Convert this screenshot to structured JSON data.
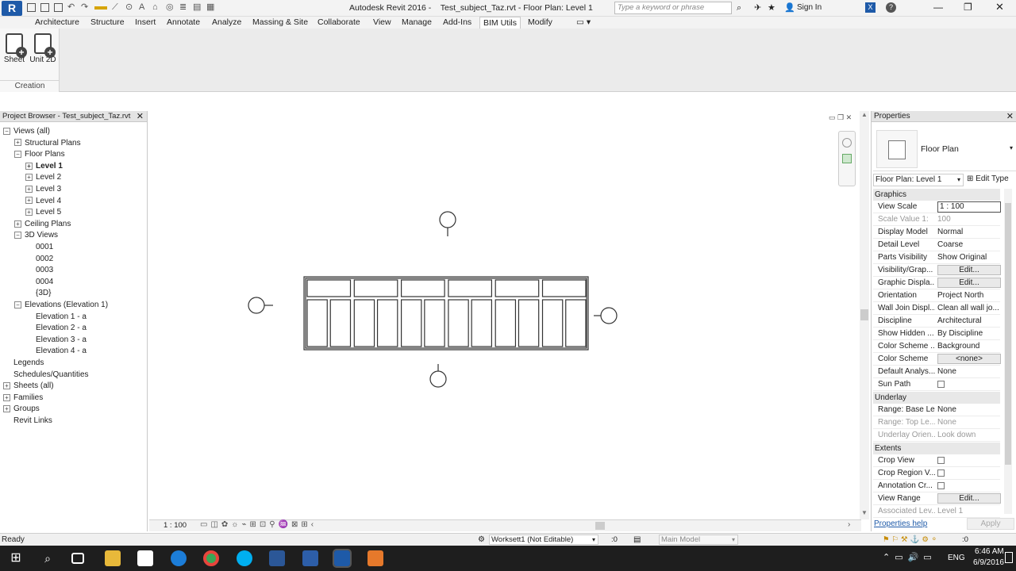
{
  "app": {
    "title": "Autodesk Revit 2016 -    Test_subject_Taz.rvt - Floor Plan: Level 1",
    "search_placeholder": "Type a keyword or phrase",
    "sign_in": "Sign In"
  },
  "ribbon": {
    "tabs": [
      "Architecture",
      "Structure",
      "Insert",
      "Annotate",
      "Analyze",
      "Massing & Site",
      "Collaborate",
      "View",
      "Manage",
      "Add-Ins",
      "BIM Utils",
      "Modify"
    ],
    "active_tab": "BIM Utils",
    "buttons": [
      {
        "label": "Sheet"
      },
      {
        "label": "Unit 2D"
      }
    ],
    "panel_label": "Creation"
  },
  "project_browser": {
    "title": "Project Browser - Test_subject_Taz.rvt",
    "items": [
      {
        "label": "Views (all)",
        "exp": "-"
      },
      {
        "label": "Structural Plans",
        "exp": "+"
      },
      {
        "label": "Floor Plans",
        "exp": "-"
      },
      {
        "label": "Level 1",
        "exp": "+",
        "bold": true
      },
      {
        "label": "Level 2",
        "exp": "+"
      },
      {
        "label": "Level 3",
        "exp": "+"
      },
      {
        "label": "Level 4",
        "exp": "+"
      },
      {
        "label": "Level 5",
        "exp": "+"
      },
      {
        "label": "Ceiling Plans",
        "exp": "+"
      },
      {
        "label": "3D Views",
        "exp": "-"
      },
      {
        "label": "0001",
        "exp": ""
      },
      {
        "label": "0002",
        "exp": ""
      },
      {
        "label": "0003",
        "exp": ""
      },
      {
        "label": "0004",
        "exp": ""
      },
      {
        "label": "{3D}",
        "exp": ""
      },
      {
        "label": "Elevations (Elevation 1)",
        "exp": "-"
      },
      {
        "label": "Elevation 1 - a",
        "exp": ""
      },
      {
        "label": "Elevation 2 - a",
        "exp": ""
      },
      {
        "label": "Elevation 3 - a",
        "exp": ""
      },
      {
        "label": "Elevation 4 - a",
        "exp": ""
      },
      {
        "label": "Legends",
        "exp": ""
      },
      {
        "label": "Schedules/Quantities",
        "exp": ""
      },
      {
        "label": "Sheets (all)",
        "exp": "+"
      },
      {
        "label": "Families",
        "exp": "+"
      },
      {
        "label": "Groups",
        "exp": "+"
      },
      {
        "label": "Revit Links",
        "exp": ""
      }
    ]
  },
  "view": {
    "scale": "1 : 100"
  },
  "properties": {
    "title": "Properties",
    "type_name": "Floor Plan",
    "instance": "Floor Plan: Level 1",
    "edit_type": "Edit Type",
    "sections": {
      "graphics": "Graphics",
      "underlay": "Underlay",
      "extents": "Extents"
    },
    "rows": [
      {
        "k": "View Scale",
        "v": "1 : 100"
      },
      {
        "k": "Scale Value    1:",
        "v": "100",
        "grey": true
      },
      {
        "k": "Display Model",
        "v": "Normal"
      },
      {
        "k": "Detail Level",
        "v": "Coarse"
      },
      {
        "k": "Parts Visibility",
        "v": "Show Original"
      },
      {
        "k": "Visibility/Grap...",
        "v": "Edit..."
      },
      {
        "k": "Graphic Displa...",
        "v": "Edit..."
      },
      {
        "k": "Orientation",
        "v": "Project North"
      },
      {
        "k": "Wall Join Displ...",
        "v": "Clean all wall jo..."
      },
      {
        "k": "Discipline",
        "v": "Architectural"
      },
      {
        "k": "Show Hidden ...",
        "v": "By Discipline"
      },
      {
        "k": "Color Scheme ...",
        "v": "Background"
      },
      {
        "k": "Color Scheme",
        "v": "<none>"
      },
      {
        "k": "Default Analys...",
        "v": "None"
      },
      {
        "k": "Sun Path",
        "v": ""
      },
      {
        "k": "Range: Base Le...",
        "v": "None"
      },
      {
        "k": "Range: Top Le...",
        "v": "None",
        "grey": true
      },
      {
        "k": "Underlay Orien...",
        "v": "Look down",
        "grey": true
      },
      {
        "k": "Crop View",
        "v": ""
      },
      {
        "k": "Crop Region V...",
        "v": ""
      },
      {
        "k": "Annotation Cr...",
        "v": ""
      },
      {
        "k": "View Range",
        "v": "Edit..."
      },
      {
        "k": "Associated Lev...",
        "v": "Level 1",
        "grey": true
      }
    ],
    "help": "Properties help",
    "apply": "Apply"
  },
  "status": {
    "text": "Ready",
    "workset": "Worksett1 (Not Editable)",
    "count": ":0",
    "model": "Main Model",
    "count2": ":0"
  },
  "taskbar": {
    "time": "6:46 AM",
    "date": "6/9/2016",
    "lang": "ENG"
  },
  "colors": {
    "accent": "#1e5aa8",
    "taskbar": "#1e1e1e"
  }
}
